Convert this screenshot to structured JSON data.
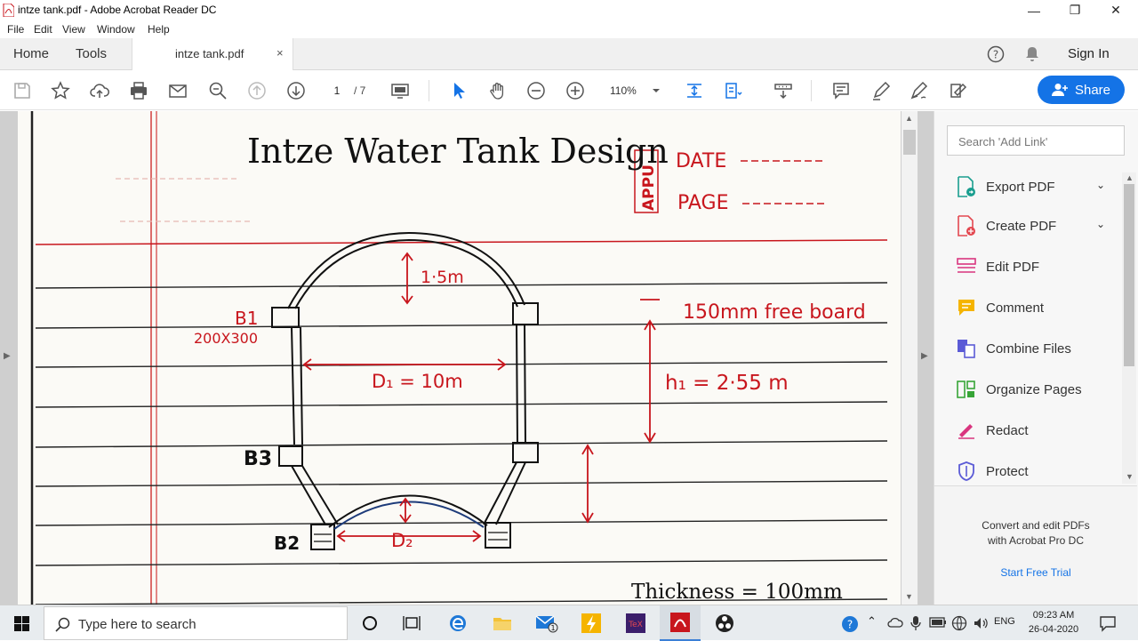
{
  "window": {
    "title": "intze tank.pdf - Adobe Acrobat Reader DC"
  },
  "menu": [
    "File",
    "Edit",
    "View",
    "Window",
    "Help"
  ],
  "tabs": {
    "home": "Home",
    "tools": "Tools",
    "document": "intze tank.pdf",
    "close": "×"
  },
  "header": {
    "sign_in": "Sign In",
    "share": "Share"
  },
  "toolbar": {
    "page_current": "1",
    "page_total": "/ 7",
    "zoom": "110%"
  },
  "document": {
    "title": "Intze Water Tank Design",
    "stamp": "APPU",
    "date_label": "DATE",
    "page_label": "PAGE",
    "b1": "B1",
    "b1_size": "200X300",
    "b3": "B3",
    "b2": "B2",
    "dome_rise": "1·5m",
    "freeboard": "150mm free board",
    "d1": "D₁ = 10m",
    "h1": "h₁ = 2·55 m",
    "d2": "D₂",
    "thickness": "Thickness = 100mm"
  },
  "right_pane": {
    "search_placeholder": "Search 'Add Link'",
    "tools": [
      {
        "label": "Export PDF",
        "icon": "export-pdf-icon",
        "color": "#1a9e8f"
      },
      {
        "label": "Create PDF",
        "icon": "create-pdf-icon",
        "color": "#e34850"
      },
      {
        "label": "Edit PDF",
        "icon": "edit-pdf-icon",
        "color": "#d9357f"
      },
      {
        "label": "Comment",
        "icon": "comment-icon",
        "color": "#f5b400"
      },
      {
        "label": "Combine Files",
        "icon": "combine-files-icon",
        "color": "#5b5bd6"
      },
      {
        "label": "Organize Pages",
        "icon": "organize-pages-icon",
        "color": "#37a537"
      },
      {
        "label": "Redact",
        "icon": "redact-icon",
        "color": "#d9357f"
      },
      {
        "label": "Protect",
        "icon": "protect-icon",
        "color": "#5b5bd6"
      }
    ],
    "promo_line1": "Convert and edit PDFs",
    "promo_line2": "with Acrobat Pro DC",
    "promo_link": "Start Free Trial"
  },
  "taskbar": {
    "search_placeholder": "Type here to search",
    "lang": "ENG",
    "time": "09:23 AM",
    "date": "26-04-2020"
  },
  "colors": {
    "accent": "#1473e6",
    "ink_red": "#c8161d",
    "ink_black": "#111111"
  }
}
